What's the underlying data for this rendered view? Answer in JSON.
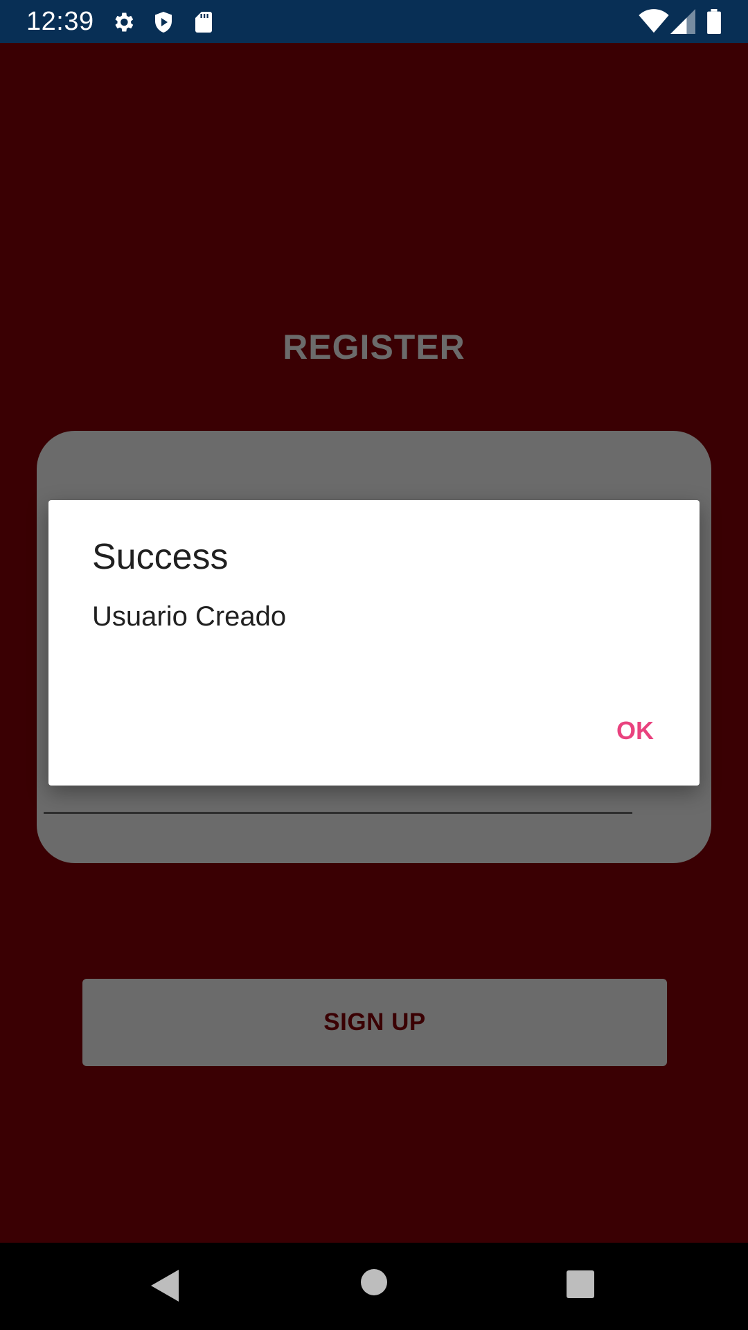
{
  "status_bar": {
    "time": "12:39",
    "left_icons": [
      "gear-icon",
      "shield-play-icon",
      "sd-card-icon"
    ],
    "right_icons": [
      "wifi-icon",
      "cell-signal-icon",
      "battery-icon"
    ]
  },
  "screen": {
    "title": "REGISTER",
    "password_value": "•••",
    "signup_label": "SIGN UP"
  },
  "dialog": {
    "title": "Success",
    "message": "Usuario Creado",
    "ok_label": "OK"
  },
  "nav_bar": {
    "icons": [
      "back-icon",
      "home-icon",
      "recents-icon"
    ]
  },
  "colors": {
    "status_bar": "#082f55",
    "background": "#3a0003",
    "card": "#6b6b6b",
    "accent": "#e9427e"
  }
}
